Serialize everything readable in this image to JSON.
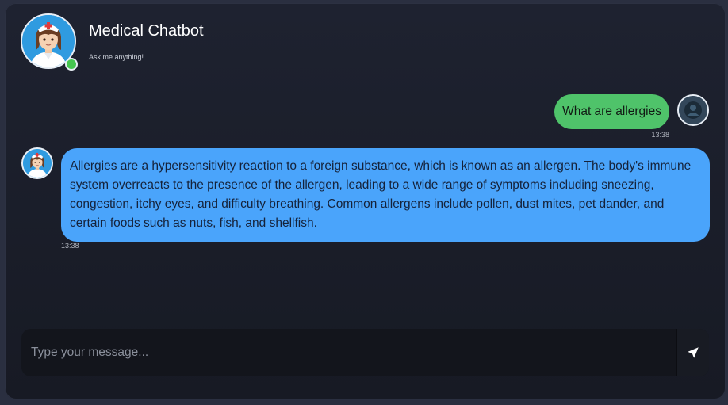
{
  "header": {
    "title": "Medical Chatbot",
    "subtitle": "Ask me anything!",
    "online_color": "#45c64f"
  },
  "messages": [
    {
      "role": "user",
      "text": "What are allergies",
      "time": "13:38",
      "bubble_color": "#4fc36a"
    },
    {
      "role": "bot",
      "text": "Allergies are a hypersensitivity reaction to a foreign substance, which is known as an allergen. The body's immune system overreacts to the presence of the allergen, leading to a wide range of symptoms including sneezing, congestion, itchy eyes, and difficulty breathing. Common allergens include pollen, dust mites, pet dander, and certain foods such as nuts, fish, and shellfish.",
      "time": "13:38",
      "bubble_color": "#4aa4fb"
    }
  ],
  "composer": {
    "placeholder": "Type your message...",
    "value": "",
    "send_icon": "send-arrow-icon"
  },
  "icons": {
    "bot_avatar": "nurse-avatar-icon",
    "user_avatar": "user-avatar-icon"
  }
}
